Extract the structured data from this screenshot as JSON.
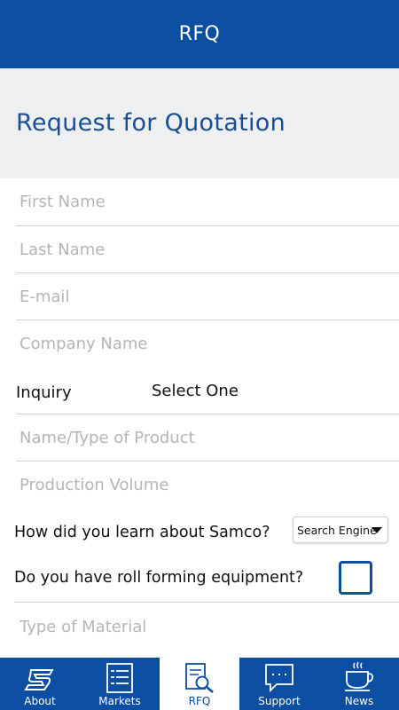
{
  "header": {
    "title": "RFQ"
  },
  "page": {
    "heading": "Request for Quotation"
  },
  "form": {
    "first_name": {
      "placeholder": "First Name"
    },
    "last_name": {
      "placeholder": "Last Name"
    },
    "email": {
      "placeholder": "E-mail"
    },
    "company": {
      "placeholder": "Company Name"
    },
    "inquiry": {
      "label": "Inquiry",
      "value": "Select One"
    },
    "product": {
      "placeholder": "Name/Type of Product"
    },
    "volume": {
      "placeholder": "Production Volume"
    },
    "learn": {
      "label": "How did you learn about Samco?",
      "value": "Search Engine"
    },
    "roll": {
      "label": "Do you have roll forming equipment?",
      "checked": false
    },
    "material": {
      "placeholder": "Type of Material"
    }
  },
  "tabs": [
    {
      "label": "About",
      "icon": "samco-logo-icon"
    },
    {
      "label": "Markets",
      "icon": "list-icon"
    },
    {
      "label": "RFQ",
      "icon": "document-search-icon",
      "active": true
    },
    {
      "label": "Support",
      "icon": "chat-bubble-icon"
    },
    {
      "label": "News",
      "icon": "coffee-cup-icon"
    }
  ],
  "colors": {
    "primary": "#0b4ea2",
    "heading": "#1b4f93",
    "band": "#eeeff1"
  }
}
